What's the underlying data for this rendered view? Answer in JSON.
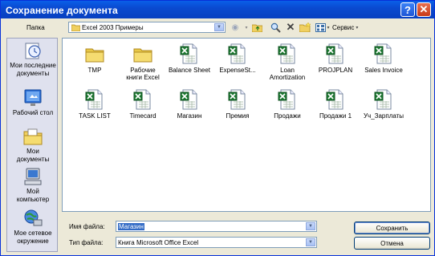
{
  "window": {
    "title": "Сохранение документа"
  },
  "toolbar": {
    "folder_label": "Папка",
    "folder_value": "Excel 2003 Примеры",
    "service_label": "Сервис"
  },
  "places": [
    {
      "label_line1": "Мои последние",
      "label_line2": "документы",
      "icon": "recent-documents-icon"
    },
    {
      "label_line1": "Рабочий стол",
      "label_line2": "",
      "icon": "desktop-icon"
    },
    {
      "label_line1": "Мои",
      "label_line2": "документы",
      "icon": "my-documents-icon"
    },
    {
      "label_line1": "Мой",
      "label_line2": "компьютер",
      "icon": "my-computer-icon"
    },
    {
      "label_line1": "Мое сетевое",
      "label_line2": "окружение",
      "icon": "network-places-icon"
    }
  ],
  "files": [
    {
      "line1": "TMP",
      "line2": "",
      "icon": "folder-icon"
    },
    {
      "line1": "Рабочие",
      "line2": "книги Excel",
      "icon": "folder-icon"
    },
    {
      "line1": "Balance Sheet",
      "line2": "",
      "icon": "excel-file-icon"
    },
    {
      "line1": "ExpenseSt...",
      "line2": "",
      "icon": "excel-file-icon"
    },
    {
      "line1": "Loan",
      "line2": "Amortization",
      "icon": "excel-file-icon"
    },
    {
      "line1": "PROJPLAN",
      "line2": "",
      "icon": "excel-file-icon"
    },
    {
      "line1": "Sales Invoice",
      "line2": "",
      "icon": "excel-file-icon"
    },
    {
      "line1": "TASK LIST",
      "line2": "",
      "icon": "excel-file-icon"
    },
    {
      "line1": "Timecard",
      "line2": "",
      "icon": "excel-file-icon"
    },
    {
      "line1": "Магазин",
      "line2": "",
      "icon": "excel-file-icon"
    },
    {
      "line1": "Премия",
      "line2": "",
      "icon": "excel-file-icon"
    },
    {
      "line1": "Продажи",
      "line2": "",
      "icon": "excel-file-icon"
    },
    {
      "line1": "Продажи 1",
      "line2": "",
      "icon": "excel-file-icon"
    },
    {
      "line1": "Уч_Зарплаты",
      "line2": "",
      "icon": "excel-file-icon"
    }
  ],
  "footer": {
    "filename_label": "Имя файла:",
    "filename_value": "Магазин",
    "filetype_label": "Тип файла:",
    "filetype_value": "Книга Microsoft Office Excel",
    "save_label": "Сохранить",
    "cancel_label": "Отмена"
  },
  "colors": {
    "titlebar": "#0a4ad0",
    "dialog_bg": "#ece9d8",
    "excel_green": "#1e7a32",
    "folder_yellow": "#f0d060"
  }
}
